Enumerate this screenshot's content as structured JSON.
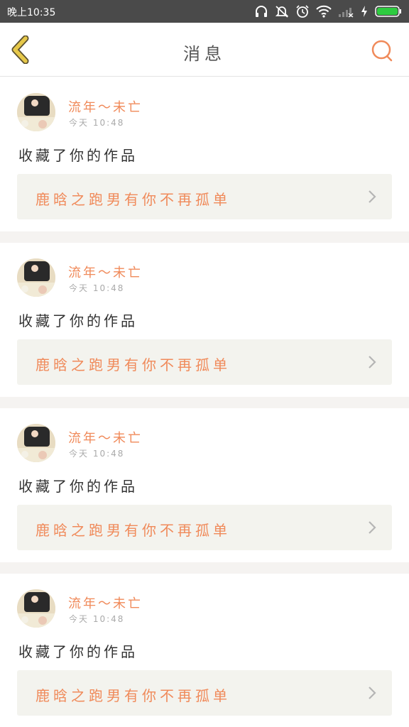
{
  "status_bar": {
    "time": "晚上10:35",
    "icons": [
      "headphones-icon",
      "mute-icon",
      "alarm-icon",
      "wifi-icon",
      "signal-icon",
      "charging-icon",
      "battery-icon"
    ]
  },
  "header": {
    "title": "消息",
    "back_icon": "chevron-left-icon",
    "search_icon": "search-icon"
  },
  "colors": {
    "accent": "#f08a5a",
    "back_arrow": "#e6c84a",
    "card_link_bg": "#f3f3ee",
    "divider": "#f5f3f1",
    "status_bar_bg": "#4a4a4a",
    "battery": "#2ecc40"
  },
  "messages": [
    {
      "username": "流年～未亡",
      "time": "今天 10:48",
      "action": "收藏了你的作品",
      "work_title": "鹿晗之跑男有你不再孤单"
    },
    {
      "username": "流年～未亡",
      "time": "今天 10:48",
      "action": "收藏了你的作品",
      "work_title": "鹿晗之跑男有你不再孤单"
    },
    {
      "username": "流年～未亡",
      "time": "今天 10:48",
      "action": "收藏了你的作品",
      "work_title": "鹿晗之跑男有你不再孤单"
    },
    {
      "username": "流年～未亡",
      "time": "今天 10:48",
      "action": "收藏了你的作品",
      "work_title": "鹿晗之跑男有你不再孤单"
    }
  ]
}
